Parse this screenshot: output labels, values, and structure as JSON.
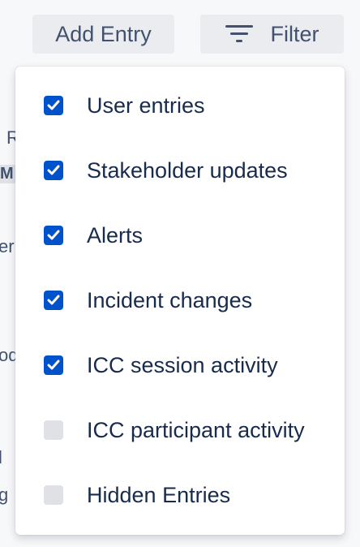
{
  "toolbar": {
    "add_entry_label": "Add Entry",
    "filter_label": "Filter"
  },
  "background_fragments": [
    "R",
    "M",
    "er",
    "od",
    "l",
    "g"
  ],
  "filter_menu": {
    "items": [
      {
        "label": "User entries",
        "checked": true
      },
      {
        "label": "Stakeholder updates",
        "checked": true
      },
      {
        "label": "Alerts",
        "checked": true
      },
      {
        "label": "Incident changes",
        "checked": true
      },
      {
        "label": "ICC session activity",
        "checked": true
      },
      {
        "label": "ICC participant activity",
        "checked": false
      },
      {
        "label": "Hidden Entries",
        "checked": false
      }
    ]
  },
  "colors": {
    "checkbox_checked": "#0052cc",
    "checkbox_unchecked": "#dfe1e6",
    "button_bg": "#eaecf0"
  }
}
